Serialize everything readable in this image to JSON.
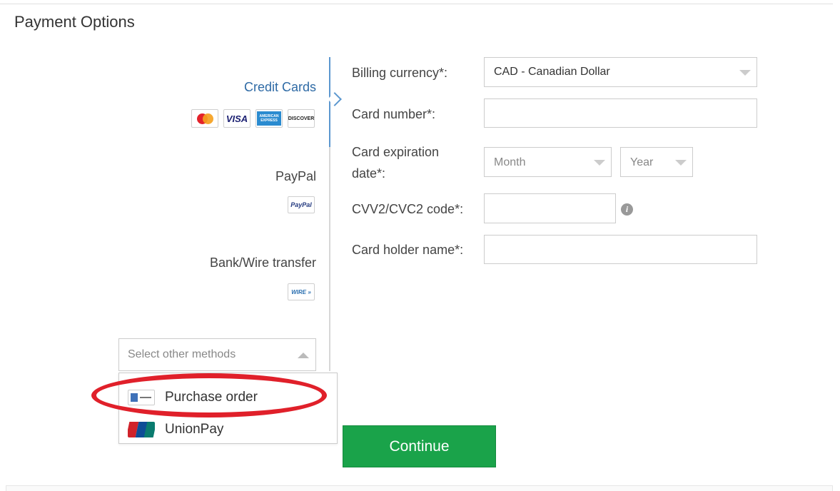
{
  "page_title": "Payment Options",
  "methods": {
    "credit_cards": {
      "label": "Credit Cards",
      "logos": {
        "visa": "VISA",
        "amex": "AMERICAN EXPRESS",
        "discover": "DISCOVER"
      }
    },
    "paypal": {
      "label": "PayPal",
      "logo": "PayPal"
    },
    "wire": {
      "label": "Bank/Wire transfer",
      "logo": "WIRE »"
    }
  },
  "other_methods": {
    "placeholder": "Select other methods",
    "options": [
      {
        "label": "Purchase order",
        "icon": "purchase-order-icon"
      },
      {
        "label": "UnionPay",
        "icon": "unionpay-icon"
      }
    ]
  },
  "form": {
    "billing_currency_label": "Billing currency*:",
    "billing_currency_value": "CAD - Canadian Dollar",
    "card_number_label": "Card number*:",
    "card_number_value": "",
    "expiration_label_line1": "Card expiration",
    "expiration_label_line2": "date*:",
    "month_placeholder": "Month",
    "year_placeholder": "Year",
    "cvv_label": "CVV2/CVC2 code*:",
    "cvv_value": "",
    "holder_label": "Card holder name*:",
    "holder_value": ""
  },
  "continue_label": "Continue",
  "colors": {
    "active_method": "#2e6aa5",
    "continue_button": "#1aa34a",
    "highlight_oval": "#e0202a"
  }
}
